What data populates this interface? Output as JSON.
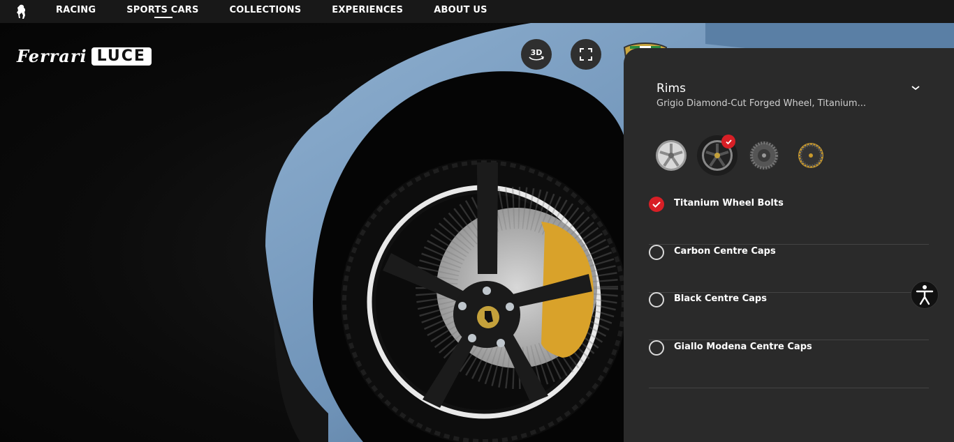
{
  "nav": {
    "items": [
      {
        "label": "RACING"
      },
      {
        "label": "SPORTS CARS"
      },
      {
        "label": "COLLECTIONS"
      },
      {
        "label": "EXPERIENCES"
      },
      {
        "label": "ABOUT US"
      }
    ],
    "active_item": "SPORTS CARS"
  },
  "logo": {
    "brand": "Ferrari",
    "product": "LUCE"
  },
  "controls": {
    "view_3d_label": "3D"
  },
  "panel": {
    "title": "Rims",
    "subtitle": "Grigio Diamond-Cut Forged Wheel, Titanium...",
    "rim_options": [
      {
        "icon": "silver-rim-icon",
        "selected": false
      },
      {
        "icon": "black-rim-icon",
        "selected": true
      },
      {
        "icon": "grey-rim-icon",
        "selected": false
      },
      {
        "icon": "gold-rim-icon",
        "selected": false
      }
    ],
    "options": [
      {
        "label": "Titanium Wheel Bolts",
        "checked": true
      },
      {
        "label": "Carbon Centre Caps",
        "checked": false
      },
      {
        "label": "Black Centre Caps",
        "checked": false
      },
      {
        "label": "Giallo Modena Centre Caps",
        "checked": false
      }
    ]
  },
  "colors": {
    "body_blue": "#6f93b8",
    "accent_red": "#d81f26",
    "caliper_yellow": "#d9a22a",
    "panel_bg": "#2a2a2a"
  }
}
